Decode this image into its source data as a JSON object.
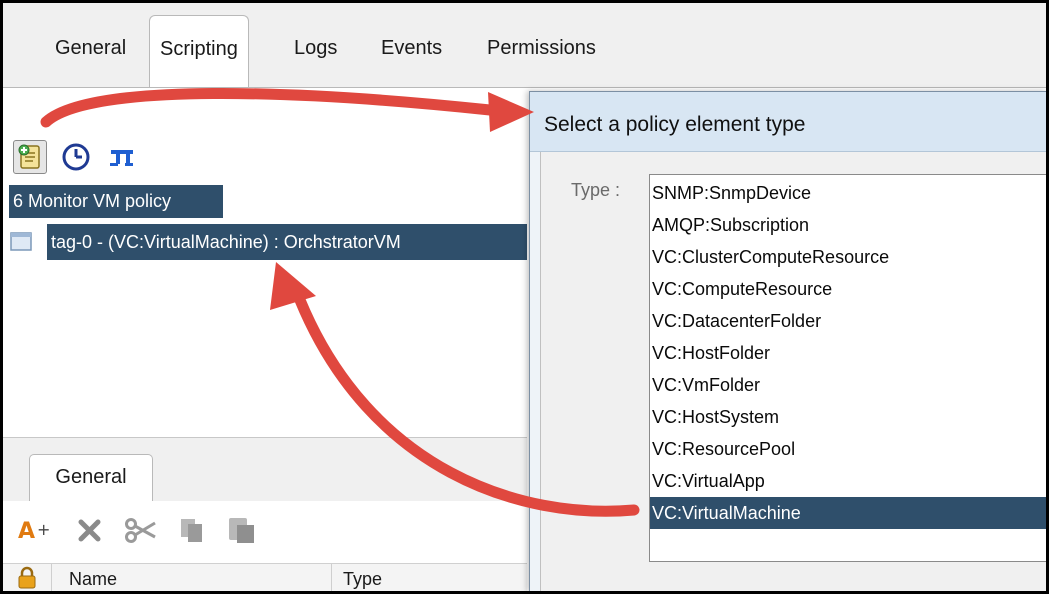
{
  "tabs": [
    {
      "label": "General",
      "active": false
    },
    {
      "label": "Scripting",
      "active": true
    },
    {
      "label": "Logs",
      "active": false
    },
    {
      "label": "Events",
      "active": false
    },
    {
      "label": "Permissions",
      "active": false
    }
  ],
  "left_panel": {
    "toolbar_icons": [
      "add-policy-element-icon",
      "clock-icon",
      "link-icon"
    ],
    "tree": {
      "root_label": "6 Monitor VM policy",
      "child_label": "tag-0 - (VC:VirtualMachine) : OrchstratorVM"
    },
    "lower_tab": "General",
    "lower_toolbar_icons": [
      "add-attribute-icon",
      "delete-icon",
      "cut-icon",
      "copy-icon",
      "paste-icon"
    ],
    "grid_columns": [
      "Name",
      "Type"
    ]
  },
  "dialog": {
    "title": "Select a policy element type",
    "type_label": "Type :",
    "options": [
      "SNMP:SnmpDevice",
      "AMQP:Subscription",
      "VC:ClusterComputeResource",
      "VC:ComputeResource",
      "VC:DatacenterFolder",
      "VC:HostFolder",
      "VC:VmFolder",
      "VC:HostSystem",
      "VC:ResourcePool",
      "VC:VirtualApp",
      "VC:VirtualMachine"
    ],
    "selected_option": "VC:VirtualMachine"
  },
  "colors": {
    "selection": "#2f4f6b",
    "annotation_arrow": "#e0483f",
    "dialog_title_bg": "#d8e6f3"
  }
}
